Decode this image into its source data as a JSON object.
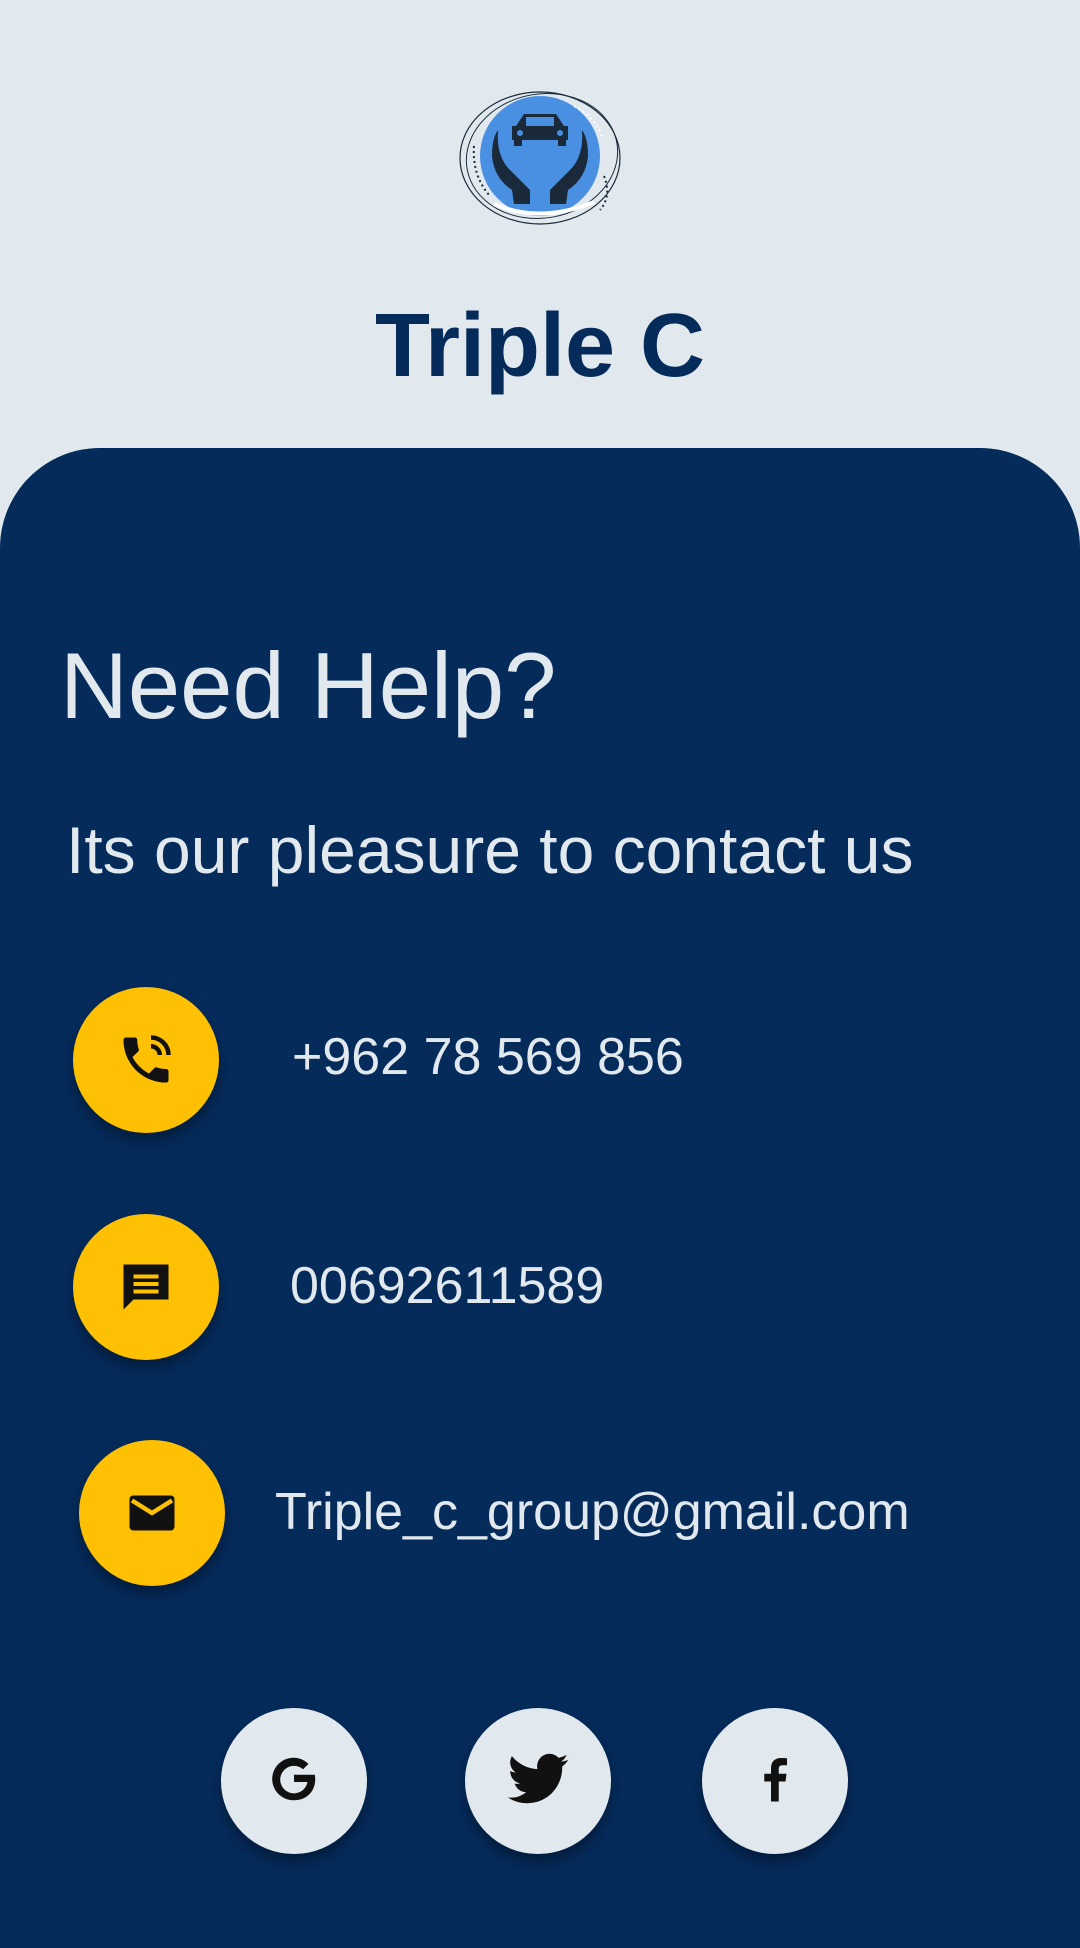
{
  "app": {
    "title": "Triple C",
    "logo_icon": "car-in-hands-icon"
  },
  "help": {
    "heading": "Need Help?",
    "subheading": "Its our pleasure to contact us"
  },
  "contacts": [
    {
      "icon": "phone-icon",
      "text": "+962 78 569 856"
    },
    {
      "icon": "message-icon",
      "text": "00692611589"
    },
    {
      "icon": "mail-icon",
      "text": "Triple_c_group@gmail.com"
    }
  ],
  "social": [
    {
      "icon": "google-icon"
    },
    {
      "icon": "twitter-icon"
    },
    {
      "icon": "facebook-icon"
    }
  ],
  "colors": {
    "background": "#e1e9ef",
    "panel": "#052b5b",
    "accent": "#fdc003",
    "logo_blue": "#4a90e2"
  }
}
